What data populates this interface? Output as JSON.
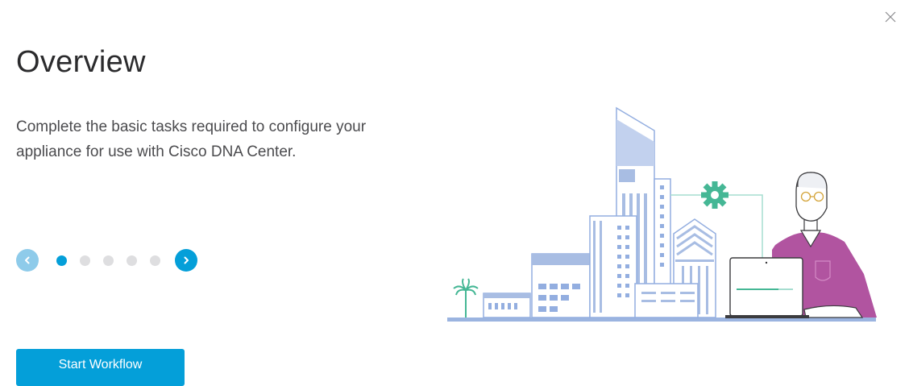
{
  "dialog": {
    "title": "Overview",
    "description": "Complete the basic tasks required to configure your appliance for use with Cisco DNA Center.",
    "start_button_label": "Start Workflow",
    "close_icon": "close-icon"
  },
  "carousel": {
    "slide_count": 5,
    "active_index": 0,
    "prev_icon": "chevron-left-icon",
    "next_icon": "chevron-right-icon"
  },
  "illustration": {
    "subject": "city-buildings-with-person-at-laptop",
    "gear_icon": "gear-icon"
  },
  "colors": {
    "accent": "#049fd9",
    "accent_disabled": "#8ecbea",
    "dot_inactive": "#dedee0",
    "building_blue": "#a8bde3",
    "building_outline": "#93aee0",
    "gear_teal": "#45b795",
    "person_shirt": "#b154a0"
  }
}
